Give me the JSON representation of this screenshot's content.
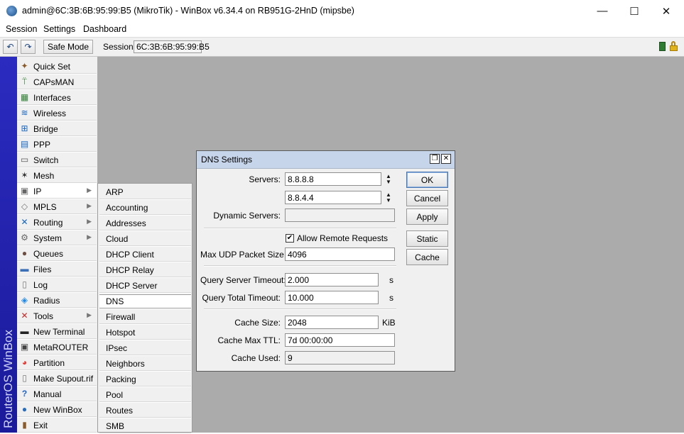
{
  "window": {
    "title": "admin@6C:3B:6B:95:99:B5 (MikroTik) - WinBox v6.34.4 on RB951G-2HnD (mipsbe)",
    "minimize": "—",
    "maximize": "☐",
    "close": "✕"
  },
  "menubar": [
    "Session",
    "Settings",
    "Dashboard"
  ],
  "toolbar": {
    "undo_glyph": "↶",
    "redo_glyph": "↷",
    "safe_mode_label": "Safe Mode",
    "session_label": "Session:",
    "session_value": "6C:3B:6B:95:99:B5"
  },
  "brand_text": "RouterOS WinBox",
  "sidebar": {
    "items": [
      {
        "label": "Quick Set",
        "icon": "wand-icon",
        "glyph": "✦",
        "color": "#8a5a2b",
        "submenu": false
      },
      {
        "label": "CAPsMAN",
        "icon": "antenna-icon",
        "glyph": "⍡",
        "color": "#2e7d32",
        "submenu": false
      },
      {
        "label": "Interfaces",
        "icon": "interfaces-icon",
        "glyph": "▦",
        "color": "#2e7d32",
        "submenu": false
      },
      {
        "label": "Wireless",
        "icon": "wireless-icon",
        "glyph": "≋",
        "color": "#1565c0",
        "submenu": false
      },
      {
        "label": "Bridge",
        "icon": "bridge-icon",
        "glyph": "⊞",
        "color": "#1565c0",
        "submenu": false
      },
      {
        "label": "PPP",
        "icon": "ppp-icon",
        "glyph": "▤",
        "color": "#1565c0",
        "submenu": false
      },
      {
        "label": "Switch",
        "icon": "switch-icon",
        "glyph": "▭",
        "color": "#555555",
        "submenu": false
      },
      {
        "label": "Mesh",
        "icon": "mesh-icon",
        "glyph": "✶",
        "color": "#333333",
        "submenu": false
      },
      {
        "label": "IP",
        "icon": "ip-icon",
        "glyph": "▣",
        "color": "#666666",
        "submenu": true
      },
      {
        "label": "MPLS",
        "icon": "mpls-icon",
        "glyph": "◇",
        "color": "#777777",
        "submenu": true
      },
      {
        "label": "Routing",
        "icon": "routing-icon",
        "glyph": "✕",
        "color": "#1565c0",
        "submenu": true
      },
      {
        "label": "System",
        "icon": "gear-icon",
        "glyph": "⚙",
        "color": "#666666",
        "submenu": true
      },
      {
        "label": "Queues",
        "icon": "queues-icon",
        "glyph": "●",
        "color": "#6d4c41",
        "submenu": false
      },
      {
        "label": "Files",
        "icon": "folder-icon",
        "glyph": "▬",
        "color": "#3b6fb6",
        "submenu": false
      },
      {
        "label": "Log",
        "icon": "log-icon",
        "glyph": "▯",
        "color": "#777777",
        "submenu": false
      },
      {
        "label": "Radius",
        "icon": "radius-icon",
        "glyph": "◈",
        "color": "#1e88e5",
        "submenu": false
      },
      {
        "label": "Tools",
        "icon": "tools-icon",
        "glyph": "✕",
        "color": "#c62828",
        "submenu": true
      },
      {
        "label": "New Terminal",
        "icon": "terminal-icon",
        "glyph": "▬",
        "color": "#222222",
        "submenu": false
      },
      {
        "label": "MetaROUTER",
        "icon": "metarouter-icon",
        "glyph": "▣",
        "color": "#444444",
        "submenu": false
      },
      {
        "label": "Partition",
        "icon": "partition-icon",
        "glyph": "◕",
        "color": "#e53935",
        "submenu": false
      },
      {
        "label": "Make Supout.rif",
        "icon": "document-icon",
        "glyph": "▯",
        "color": "#777777",
        "submenu": false
      },
      {
        "label": "Manual",
        "icon": "help-icon",
        "glyph": "?",
        "color": "#1e63c8",
        "submenu": false
      },
      {
        "label": "New WinBox",
        "icon": "winbox-icon",
        "glyph": "●",
        "color": "#2a6ebb",
        "submenu": false
      },
      {
        "label": "Exit",
        "icon": "exit-icon",
        "glyph": "▮",
        "color": "#8a5a2b",
        "submenu": false
      }
    ],
    "submenu_glyph": "▶"
  },
  "ip_submenu": [
    "ARP",
    "Accounting",
    "Addresses",
    "Cloud",
    "DHCP Client",
    "DHCP Relay",
    "DHCP Server",
    "DNS",
    "Firewall",
    "Hotspot",
    "IPsec",
    "Neighbors",
    "Packing",
    "Pool",
    "Routes",
    "SMB"
  ],
  "dns_dialog": {
    "title": "DNS Settings",
    "restore_glyph": "❐",
    "close_glyph": "✕",
    "servers_label": "Servers:",
    "server1": "8.8.8.8",
    "server2": "8.8.4.4",
    "spin_up": "▲",
    "spin_down": "▼",
    "dynamic_servers_label": "Dynamic Servers:",
    "dynamic_servers_value": "",
    "allow_remote_label": "Allow Remote Requests",
    "allow_remote_checked": "✔",
    "max_udp_label": "Max UDP Packet Size:",
    "max_udp_value": "4096",
    "query_server_timeout_label": "Query Server Timeout:",
    "query_server_timeout_value": "2.000",
    "query_total_timeout_label": "Query Total Timeout:",
    "query_total_timeout_value": "10.000",
    "seconds_unit": "s",
    "cache_size_label": "Cache Size:",
    "cache_size_value": "2048",
    "cache_size_unit": "KiB",
    "cache_max_ttl_label": "Cache Max TTL:",
    "cache_max_ttl_value": "7d 00:00:00",
    "cache_used_label": "Cache Used:",
    "cache_used_value": "9",
    "buttons": {
      "ok": "OK",
      "cancel": "Cancel",
      "apply": "Apply",
      "static": "Static",
      "cache": "Cache"
    }
  },
  "status": {
    "green_indicator": "#2e7d32",
    "lock_color": "#d4a017"
  }
}
